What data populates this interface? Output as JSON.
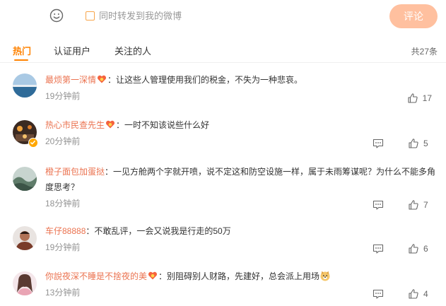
{
  "compose": {
    "emoji_icon": "smiley-icon",
    "repost_label": "同时转发到我的微博",
    "submit_label": "评论"
  },
  "tabs": {
    "hot": "热门",
    "verified": "认证用户",
    "following": "关注的人",
    "total": "共27条"
  },
  "comments": [
    {
      "user": "最烦第一深情",
      "text": "：让这些人管理使用我们的税金，不失为一种悲哀。",
      "time": "19分钟前",
      "likes": "17",
      "verified": false
    },
    {
      "user": "热心市民查先生",
      "text": "：一时不知该说些什么好",
      "time": "20分钟前",
      "likes": "5",
      "verified": true
    },
    {
      "user": "橙子面包加蛋挞",
      "text": "：一见方舱两个字就开喷，说不定这和防空设施一样，属于未雨筹谋呢？为什么不能多角度思考？",
      "time": "18分钟前",
      "likes": "7",
      "verified": false
    },
    {
      "user": "车仔88888",
      "text": "：不敢乱评，一会又说我是行走的50万",
      "time": "19分钟前",
      "likes": "6",
      "verified": false
    },
    {
      "user": "你說夜深不睡是不捨夜的美",
      "text": "：别阻碍别人财路，先建好，总会派上用场",
      "time": "13分钟前",
      "likes": "4",
      "verified": false
    }
  ],
  "colors": {
    "accent": "#ff8200",
    "username": "#eb7350",
    "button": "#ffc09f"
  }
}
